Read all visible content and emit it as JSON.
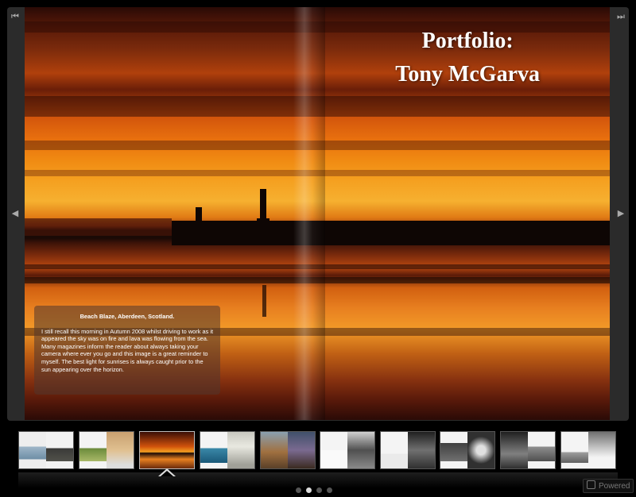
{
  "spread": {
    "title_line1": "Portfolio:",
    "title_line2": "Tony McGarva",
    "caption_title": "Beach Blaze, Aberdeen, Scotland.",
    "caption_body": "I still recall this morning in Autumn 2008 whilst driving to work as it appeared the sky was on fire and lava was flowing from the sea. Many magazines inform the reader about always taking your camera where ever you go and this image is a great reminder to myself. The best light for sunrises is always caught prior to the sun appearing over the horizon."
  },
  "navigation": {
    "first_icon": "first-page-icon",
    "last_icon": "last-page-icon",
    "prev_icon": "prev-page-icon",
    "next_icon": "next-page-icon"
  },
  "thumbnails": [
    {
      "id": "t1",
      "active": false
    },
    {
      "id": "t2",
      "active": false
    },
    {
      "id": "t3",
      "active": true
    },
    {
      "id": "t4",
      "active": false
    },
    {
      "id": "t5",
      "active": false
    },
    {
      "id": "t6",
      "active": false
    },
    {
      "id": "t7",
      "active": false
    },
    {
      "id": "t8",
      "active": false
    },
    {
      "id": "t9",
      "active": false
    },
    {
      "id": "t10",
      "active": false
    }
  ],
  "pager": {
    "count": 4,
    "active_index": 1
  },
  "footer": {
    "powered_label": "Powered"
  },
  "colors": {
    "accent": "#f08a12",
    "background": "#000000"
  }
}
